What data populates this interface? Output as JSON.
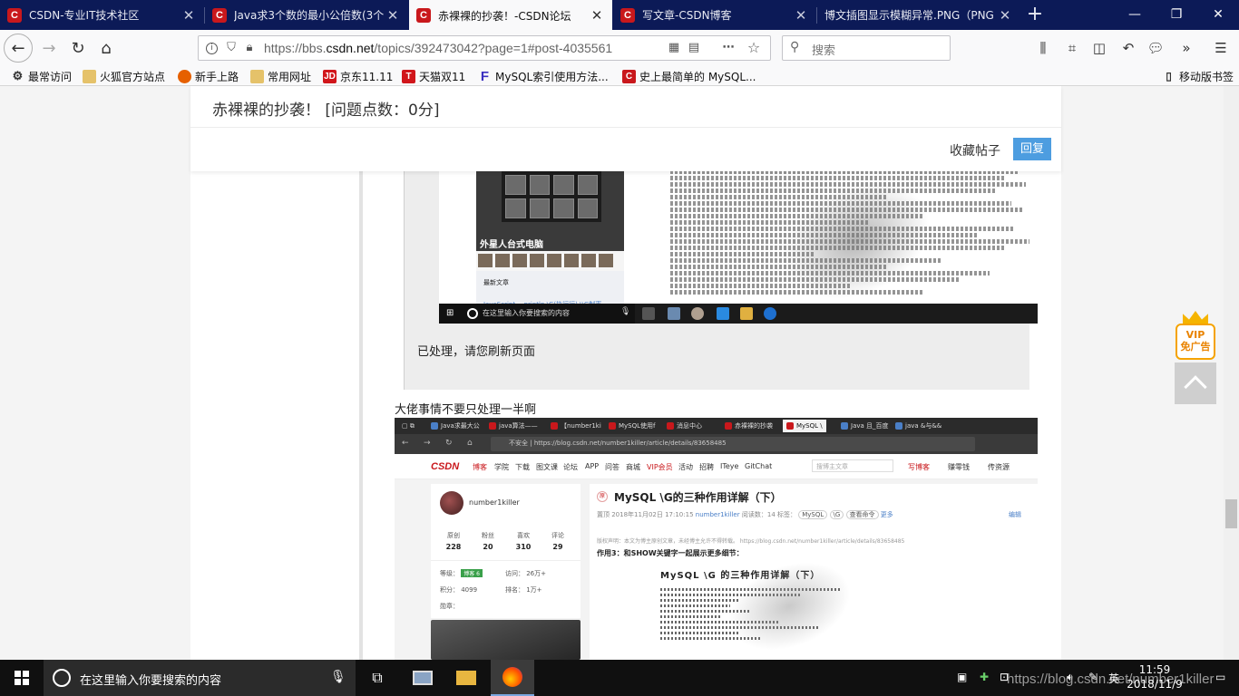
{
  "browser": {
    "tabs": [
      {
        "title": "CSDN-专业IT技术社区",
        "active": false
      },
      {
        "title": "Java求3个数的最小公倍数(3个",
        "active": false
      },
      {
        "title": "赤裸裸的抄袭！-CSDN论坛",
        "active": true
      },
      {
        "title": "写文章-CSDN博客",
        "active": false
      },
      {
        "title": "博文插图显示模糊异常.PNG（PNG",
        "active": false
      }
    ],
    "url_prefix": "https://bbs.",
    "url_domain": "csdn.net",
    "url_rest": "/topics/392473042?page=1#post-4035561",
    "search_placeholder": "搜索",
    "bookmarks": [
      {
        "label": "最常访问",
        "icon": "gear-icon"
      },
      {
        "label": "火狐官方站点",
        "icon": "folder-icon"
      },
      {
        "label": "新手上路",
        "icon": "firefox-icon"
      },
      {
        "label": "常用网址",
        "icon": "folder-icon"
      },
      {
        "label": "京东11.11",
        "icon": "jd-icon"
      },
      {
        "label": "天猫双11",
        "icon": "tmall-icon"
      },
      {
        "label": "MySQL索引使用方法...",
        "icon": "f-icon"
      },
      {
        "label": "史上最简单的 MySQL...",
        "icon": "csdn-icon"
      }
    ],
    "mobile_bookmarks": "移动版书签"
  },
  "thread": {
    "title": "赤裸裸的抄袭！ [问题点数：0分]",
    "collect_label": "收藏帖子",
    "reply_label": "回复",
    "handled_text": "已处理，请您刷新页面",
    "comment_text": "大佬事情不要只处理一半啊"
  },
  "shot1": {
    "caption": "外星人台式电脑",
    "latest": "最新文章",
    "latest_sub": "JavaScript -- println \\G(执行行)  \\\\G制率",
    "taskbar_search": "在这里输入你要搜索的内容"
  },
  "shot2": {
    "tabs": [
      "Java求最大公",
      "java算法——",
      "【number1ki",
      "MySQL使用f",
      "消息中心",
      "赤裸裸的抄袭",
      "MySQL \\",
      "Java 且_百度",
      "java &与&&"
    ],
    "url_insecure": "不安全",
    "url": "https://blog.csdn.net/number1killer/article/details/83658485",
    "logo": "CSDN",
    "menu": [
      "博客",
      "学院",
      "下载",
      "图文课",
      "论坛",
      "APP",
      "问答",
      "商城",
      "VIP会员",
      "活动",
      "招聘",
      "ITeye",
      "GitChat"
    ],
    "search_placeholder": "搜博主文章",
    "right_links": [
      "写博客",
      "赚零钱",
      "传资源"
    ],
    "profile": {
      "name": "number1killer",
      "stats": [
        {
          "label": "原创",
          "value": "228"
        },
        {
          "label": "粉丝",
          "value": "20"
        },
        {
          "label": "喜欢",
          "value": "310"
        },
        {
          "label": "评论",
          "value": "29"
        }
      ],
      "level_label": "等级：",
      "level_badge": "博客 6",
      "visits": "访问：  26万+",
      "points": "积分：  4099",
      "rank": "排名：  1万+",
      "medal": "勋章："
    },
    "article": {
      "yuan": "原",
      "title": "MySQL \\G的三种作用详解（下）",
      "meta_prefix": "置顶   2018年11月02日 17:10:15",
      "author": "number1killer",
      "reads": "阅读数：14",
      "tags_label": "标签：",
      "tags": [
        "MySQL",
        "\\G",
        "查看命令"
      ],
      "more": "更多",
      "edit": "编辑",
      "copyright": "版权声明：本文为博主原创文章，未经博主允许不得转载。 https://blog.csdn.net/number1killer/article/details/83658485",
      "subtitle": "作用3：和SHOW关键字一起展示更多细节：",
      "inner_title": "MySQL \\G 的三种作用详解（下）"
    }
  },
  "vip": {
    "line1": "VIP",
    "line2": "免广告"
  },
  "taskbar": {
    "search_placeholder": "在这里输入你要搜索的内容",
    "time": "11:59",
    "date": "2018/11/9",
    "ime": "英",
    "watermark": "https://blog.csdn.net/number1killer"
  }
}
